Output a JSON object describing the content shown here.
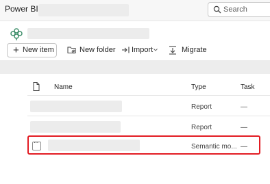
{
  "app": {
    "name": "Power BI"
  },
  "search": {
    "placeholder": "Search"
  },
  "toolbar": {
    "new_item_label": "New item",
    "new_folder_label": "New folder",
    "import_label": "Import",
    "migrate_label": "Migrate"
  },
  "table": {
    "columns": {
      "name": "Name",
      "type": "Type",
      "task": "Task"
    },
    "rows": [
      {
        "type": "Report",
        "task": "—"
      },
      {
        "type": "Report",
        "task": "—"
      },
      {
        "type": "Semantic mo...",
        "task": "—"
      }
    ]
  },
  "colors": {
    "highlight": "#e21b22",
    "workspace_icon": "#3f8f6b"
  },
  "icons": {
    "search": "search-icon",
    "workspace": "workspace-icon",
    "new_folder": "folder-add-icon",
    "import": "import-icon",
    "migrate": "migrate-icon",
    "document": "document-icon",
    "more": "more-options-icon"
  }
}
